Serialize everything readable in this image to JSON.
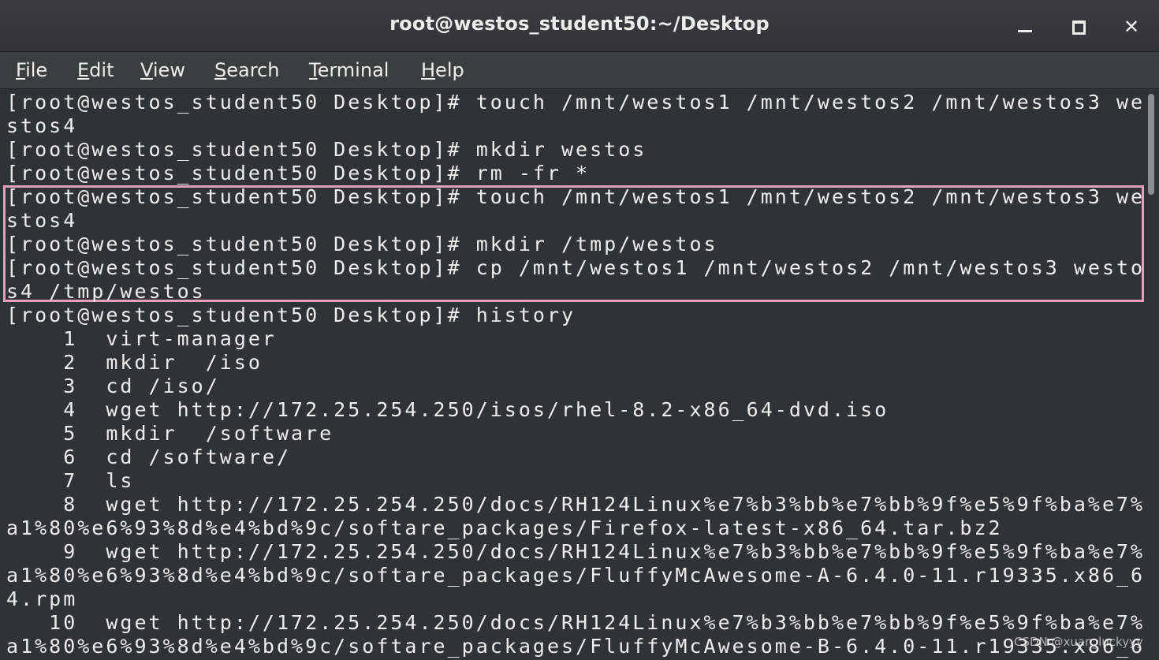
{
  "window": {
    "title": "root@westos_student50:~/Desktop",
    "controls": {
      "minimize_icon": "minimize-icon",
      "maximize_icon": "maximize-icon",
      "close_icon": "close-icon",
      "close_glyph": "✕"
    }
  },
  "menu": {
    "items": [
      {
        "mnemonic": "F",
        "rest": "ile"
      },
      {
        "mnemonic": "E",
        "rest": "dit"
      },
      {
        "mnemonic": "V",
        "rest": "iew"
      },
      {
        "mnemonic": "S",
        "rest": "earch"
      },
      {
        "mnemonic": "T",
        "rest": "erminal"
      },
      {
        "mnemonic": "H",
        "rest": "elp"
      }
    ]
  },
  "terminal": {
    "lines": [
      "[root@westos_student50 Desktop]# touch /mnt/westos1 /mnt/westos2 /mnt/westos3 we",
      "stos4",
      "[root@westos_student50 Desktop]# mkdir westos",
      "[root@westos_student50 Desktop]# rm -fr *",
      "[root@westos_student50 Desktop]# touch /mnt/westos1 /mnt/westos2 /mnt/westos3 we",
      "stos4",
      "[root@westos_student50 Desktop]# mkdir /tmp/westos",
      "[root@westos_student50 Desktop]# cp /mnt/westos1 /mnt/westos2 /mnt/westos3 westo",
      "s4 /tmp/westos",
      "[root@westos_student50 Desktop]# history",
      "    1  virt-manager",
      "    2  mkdir  /iso",
      "    3  cd /iso/",
      "    4  wget http://172.25.254.250/isos/rhel-8.2-x86_64-dvd.iso",
      "    5  mkdir  /software",
      "    6  cd /software/",
      "    7  ls",
      "    8  wget http://172.25.254.250/docs/RH124Linux%e7%b3%bb%e7%bb%9f%e5%9f%ba%e7%",
      "a1%80%e6%93%8d%e4%bd%9c/softare_packages/Firefox-latest-x86_64.tar.bz2",
      "    9  wget http://172.25.254.250/docs/RH124Linux%e7%b3%bb%e7%bb%9f%e5%9f%ba%e7%",
      "a1%80%e6%93%8d%e4%bd%9c/softare_packages/FluffyMcAwesome-A-6.4.0-11.r19335.x86_6",
      "4.rpm",
      "   10  wget http://172.25.254.250/docs/RH124Linux%e7%b3%bb%e7%bb%9f%e5%9f%ba%e7%",
      "a1%80%e6%93%8d%e4%bd%9c/softare_packages/FluffyMcAwesome-B-6.4.0-11.r19335.x86_6"
    ]
  },
  "watermark": "CSDN @xuan_luckyyy"
}
